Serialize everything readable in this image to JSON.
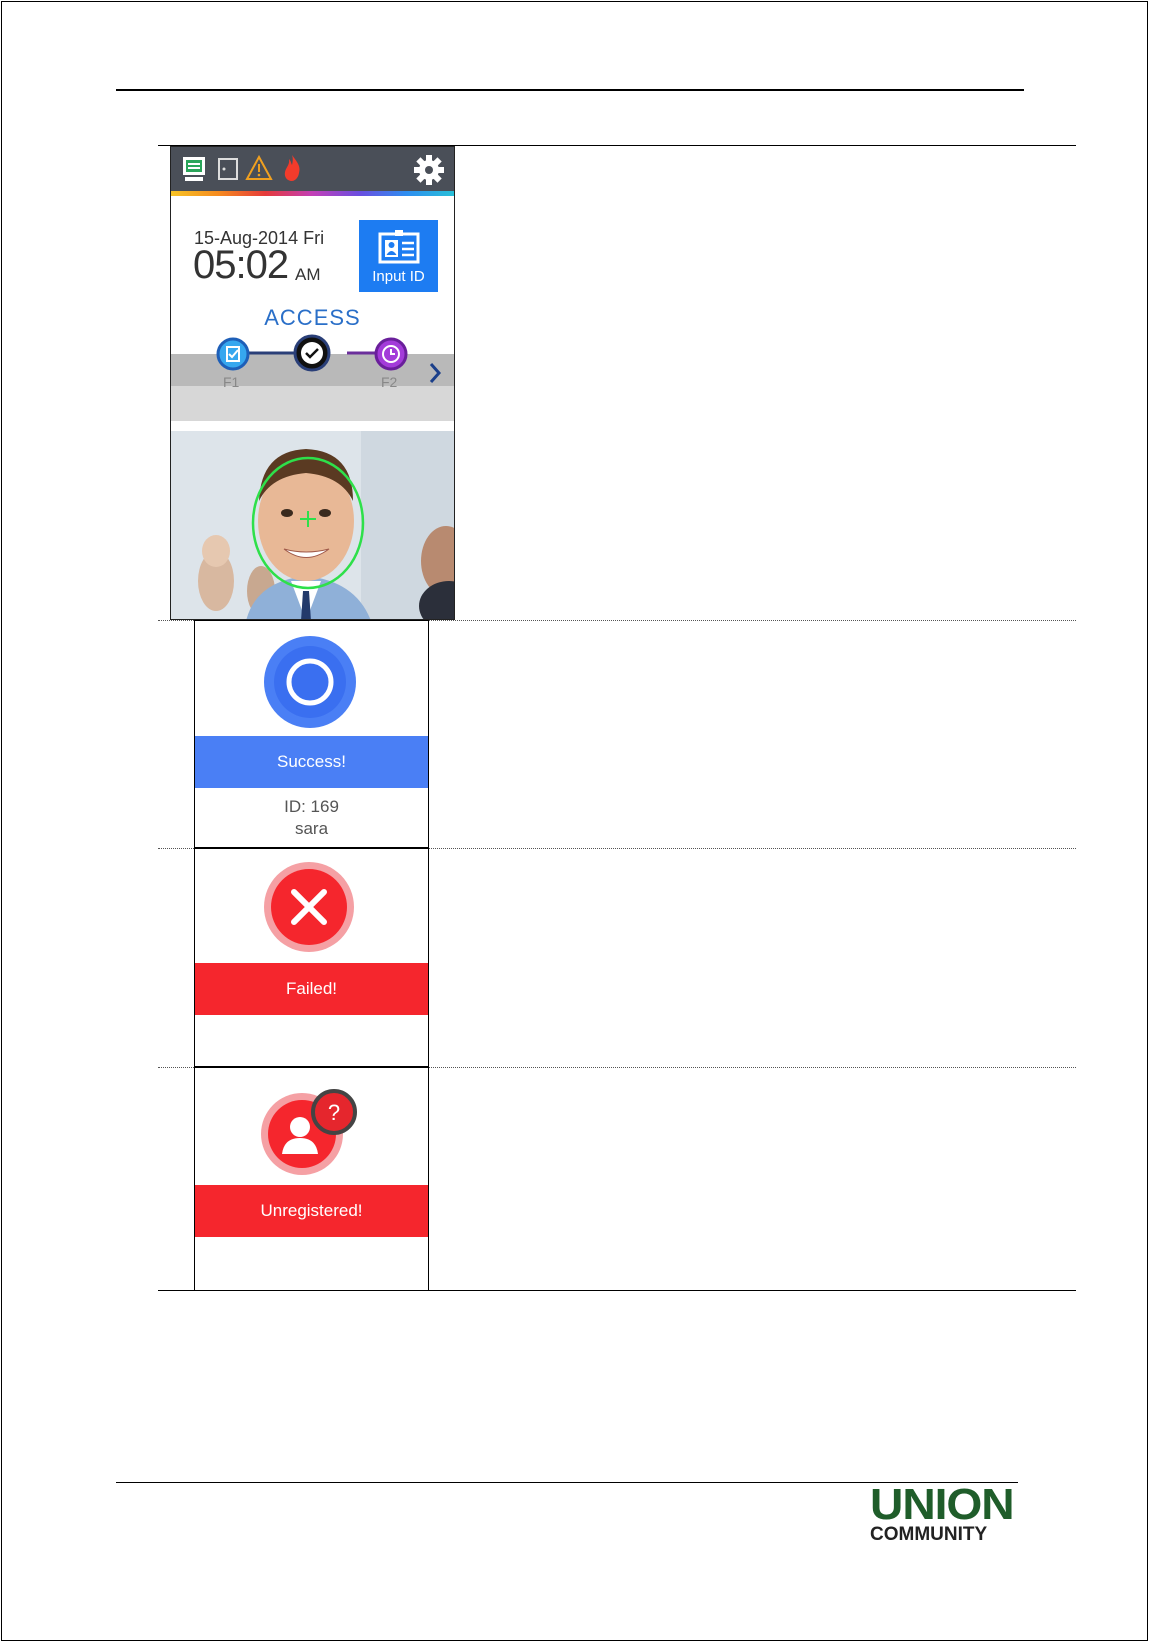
{
  "device_screen": {
    "status_icons": [
      "network-icon",
      "door-icon",
      "warning-icon",
      "fire-icon"
    ],
    "settings_icon": "gear-icon",
    "date": "15-Aug-2014 Fri",
    "time": "05:02",
    "ampm": "AM",
    "input_id_label": "Input ID",
    "mode_title": "ACCESS",
    "mode_keys": {
      "f1": "F1",
      "f2": "F2"
    }
  },
  "results": {
    "success": {
      "label": "Success!",
      "id_line": "ID: 169",
      "name": "sara",
      "color": "#4a7ff5"
    },
    "failed": {
      "label": "Failed!",
      "color": "#f5262d"
    },
    "unregistered": {
      "label": "Unregistered!",
      "badge": "?",
      "color": "#f5262d"
    }
  },
  "footer": {
    "logo_top": "UNION",
    "logo_bottom": "COMMUNITY",
    "logo_color": "#1f5d2a"
  }
}
